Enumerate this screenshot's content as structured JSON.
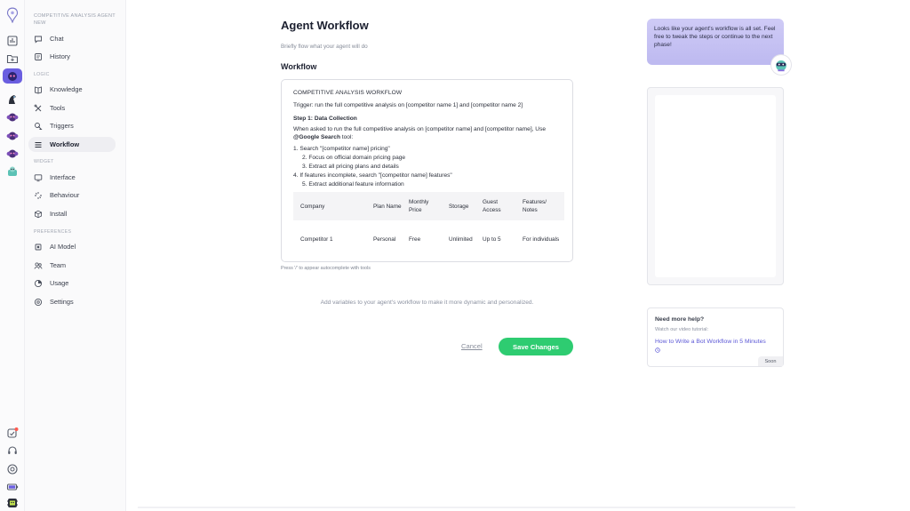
{
  "sidebar": {
    "workspace_name": "COMPETITIVE ANALYSIS AGENT NEW",
    "sections": {
      "logic": "LOGIC",
      "widget": "WIDGET",
      "preferences": "PREFERENCES"
    },
    "items": [
      {
        "label": "Chat",
        "icon": "chat-icon"
      },
      {
        "label": "History",
        "icon": "history-icon"
      },
      {
        "label": "Knowledge",
        "icon": "knowledge-icon"
      },
      {
        "label": "Tools",
        "icon": "tools-icon"
      },
      {
        "label": "Triggers",
        "icon": "triggers-icon"
      },
      {
        "label": "Workflow",
        "icon": "workflow-icon",
        "active": true
      },
      {
        "label": "Interface",
        "icon": "interface-icon"
      },
      {
        "label": "Behaviour",
        "icon": "behaviour-icon"
      },
      {
        "label": "Install",
        "icon": "install-icon"
      },
      {
        "label": "AI Model",
        "icon": "ai-model-icon"
      },
      {
        "label": "Team",
        "icon": "team-icon"
      },
      {
        "label": "Usage",
        "icon": "usage-icon"
      },
      {
        "label": "Settings",
        "icon": "settings-icon"
      }
    ]
  },
  "main": {
    "title": "Agent Workflow",
    "subtitle": "Briefly flow what your agent will do",
    "section_title": "Workflow",
    "editor": {
      "heading": "COMPETITIVE ANALYSIS WORKFLOW",
      "trigger": "Trigger: run the full competitive analysis on [competitor name 1] and [competitor name 2]",
      "step_title": "Step 1: Data Collection",
      "desc_before": "When asked to run the full competitive analysis on [competitor name] and [competitor name], Use ",
      "desc_tool": "@Google Search",
      "desc_after": " tool:",
      "list": [
        "1.  Search \"[competitor name] pricing\"",
        "2.  Focus on official domain pricing page",
        "3.  Extract all pricing plans and details",
        "4.  If features incomplete, search \"[competitor name] features\"",
        "5.  Extract additional feature information"
      ],
      "table": {
        "headers": [
          "Company",
          "Plan Name",
          "Monthly Price",
          "Storage",
          "Guest Access",
          "Features/ Notes"
        ],
        "rows": [
          [
            "Competitor 1",
            "Personal",
            "Free",
            "Unlimited",
            "Up to 5",
            "For individuals"
          ]
        ]
      }
    },
    "hint": "Press '/' to appear autocomplete with tools",
    "variables_text": "Add variables to your agent's workflow to make it more dynamic and personalized.",
    "cancel_label": "Cancel",
    "save_label": "Save Changes"
  },
  "right": {
    "bubble_text": "Looks like your agent's workflow is all set. Feel free to tweak the steps or continue to the next phase!",
    "help_title": "Need more help?",
    "help_sub": "Watch our video tutorial:",
    "help_link": "How to Write a Bot Workflow in 5 Minutes",
    "soon_label": "Soon"
  },
  "colors": {
    "accent": "#5b57d6",
    "save": "#2ecc71",
    "bubble": "#c8c5f4"
  }
}
